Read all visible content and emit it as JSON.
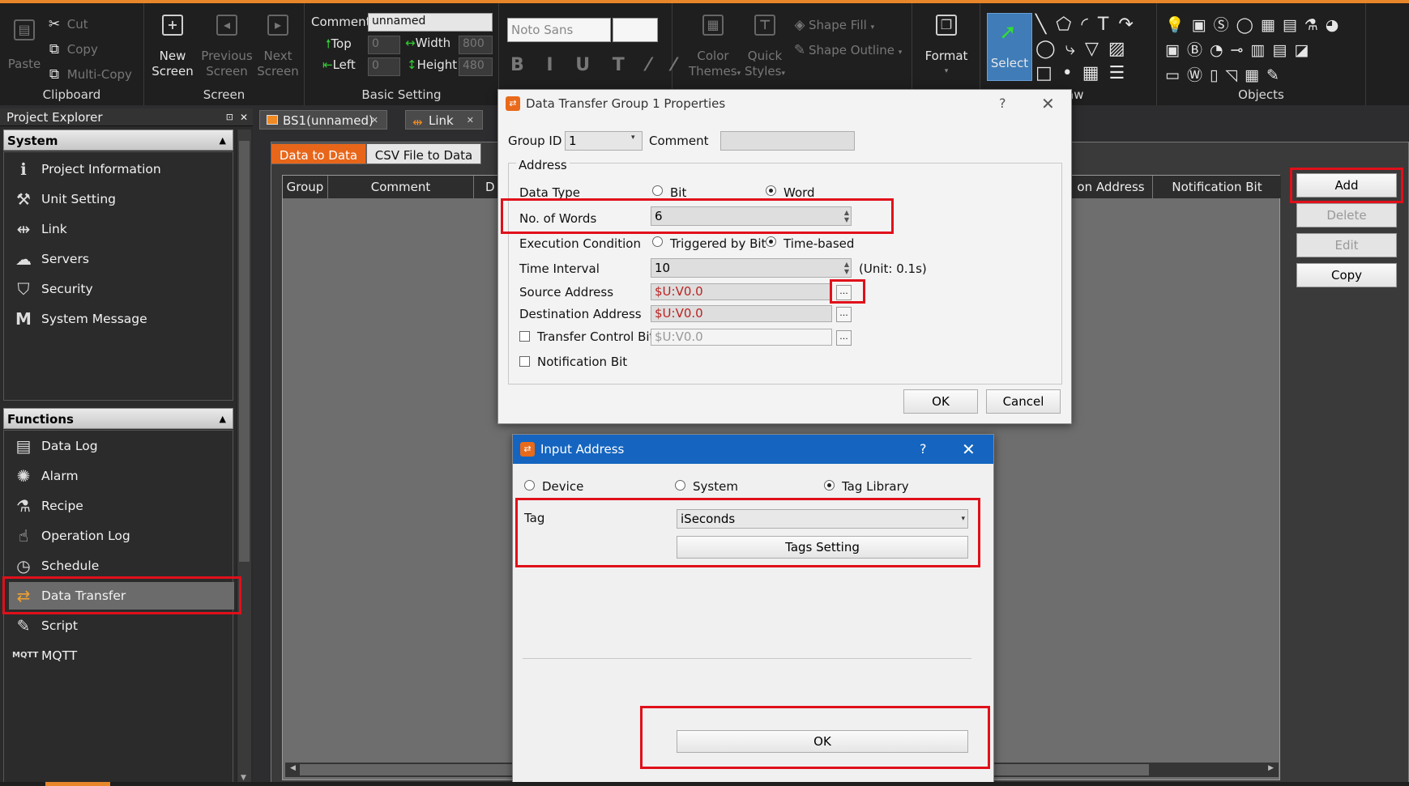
{
  "ribbon": {
    "clipboard": {
      "label": "Clipboard",
      "paste": "Paste",
      "cut": "Cut",
      "copy": "Copy",
      "multi_copy": "Multi-Copy"
    },
    "screen": {
      "label": "Screen",
      "new_screen": [
        "New",
        "Screen"
      ],
      "previous_screen": [
        "Previous",
        "Screen"
      ],
      "next_screen": [
        "Next",
        "Screen"
      ]
    },
    "basic_setting": {
      "label": "Basic Setting",
      "comment_label": "Comment",
      "comment_value": "unnamed",
      "top_label": "Top",
      "top_value": "0",
      "left_label": "Left",
      "left_value": "0",
      "width_label": "Width",
      "width_value": "800",
      "height_label": "Height",
      "height_value": "480"
    },
    "font": {
      "family": "Noto Sans"
    },
    "style": {
      "color_themes": [
        "Color",
        "Themes"
      ],
      "quick_styles": [
        "Quick",
        "Styles"
      ],
      "shape_fill": "Shape Fill",
      "shape_outline": "Shape Outline"
    },
    "format": "Format",
    "select": "Select",
    "draw_label": "aw",
    "objects_label": "Objects"
  },
  "explorer": {
    "title": "Project Explorer",
    "system_header": "System",
    "system_items": [
      "Project Information",
      "Unit Setting",
      "Link",
      "Servers",
      "Security",
      "System Message"
    ],
    "functions_header": "Functions",
    "function_items": [
      "Data Log",
      "Alarm",
      "Recipe",
      "Operation Log",
      "Schedule",
      "Data Transfer",
      "Script",
      "MQTT"
    ]
  },
  "doc_tabs": [
    "BS1(unnamed)",
    "Link"
  ],
  "inner_tabs": [
    "Data to Data",
    "CSV File to Data"
  ],
  "grid": {
    "columns": [
      "Group",
      "Comment",
      "D",
      "on Address",
      "Notification Bit"
    ]
  },
  "side_buttons": {
    "add": "Add",
    "delete": "Delete",
    "edit": "Edit",
    "copy": "Copy"
  },
  "props_dialog": {
    "title": "Data Transfer Group 1 Properties",
    "help": "?",
    "group_id_label": "Group ID",
    "group_id_value": "1",
    "comment_label": "Comment",
    "address_label": "Address",
    "data_type_label": "Data Type",
    "bit_label": "Bit",
    "word_label": "Word",
    "words_label": "No. of Words",
    "words_value": "6",
    "exec_label": "Execution Condition",
    "triggered_label": "Triggered by Bit",
    "timebased_label": "Time-based",
    "interval_label": "Time Interval",
    "interval_value": "10",
    "interval_unit": "(Unit: 0.1s)",
    "source_label": "Source Address",
    "source_value": "$U:V0.0",
    "dest_label": "Destination Address",
    "dest_value": "$U:V0.0",
    "control_label": "Transfer Control Bit",
    "control_value": "$U:V0.0",
    "notify_label": "Notification Bit",
    "ok": "OK",
    "cancel": "Cancel"
  },
  "input_dialog": {
    "title": "Input Address",
    "help": "?",
    "device": "Device",
    "system": "System",
    "tag_library": "Tag Library",
    "tag_label": "Tag",
    "tag_value": "iSeconds",
    "tags_setting": "Tags Setting",
    "ok": "OK"
  },
  "colors": {
    "accent_orange": "#e8862a",
    "highlight_red": "#e0101a",
    "address_red": "#b22222",
    "titlebar_blue": "#1565c0"
  }
}
